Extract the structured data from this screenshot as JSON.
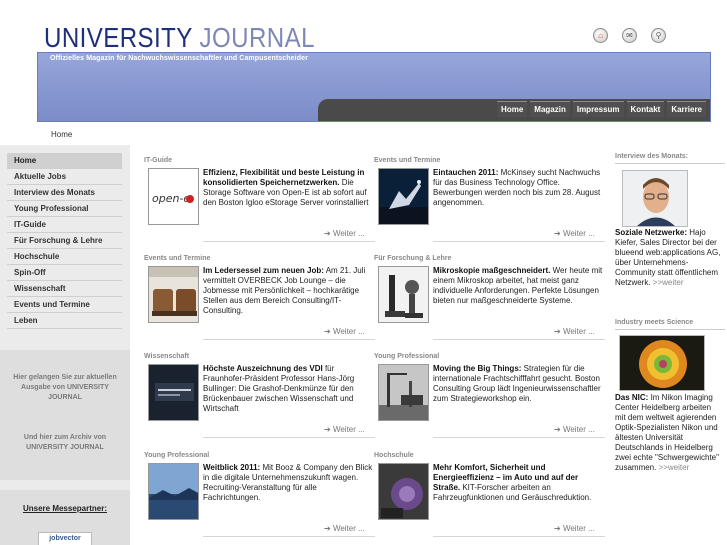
{
  "header": {
    "logo_part1": "UNIVERSITY",
    "logo_part2": "JOURNAL",
    "tagline": "Offizielles Magazin für Nachwuchswissenschaftler und Campusentscheider",
    "nav": [
      "Home",
      "Magazin",
      "Impressum",
      "Kontakt",
      "Karriere"
    ],
    "icons": [
      "home-icon",
      "mail-icon",
      "search-icon"
    ]
  },
  "breadcrumb": "Home",
  "sidebar": {
    "items": [
      {
        "label": "Home",
        "active": true
      },
      {
        "label": "Aktuelle Jobs"
      },
      {
        "label": "Interview des Monats"
      },
      {
        "label": "Young Professional"
      },
      {
        "label": "IT-Guide"
      },
      {
        "label": "Für Forschung & Lehre"
      },
      {
        "label": "Hochschule"
      },
      {
        "label": "Spin-Off"
      },
      {
        "label": "Wissenschaft"
      },
      {
        "label": "Events und Termine"
      },
      {
        "label": "Leben"
      }
    ],
    "archive_text_1": "Hier gelangen Sie zur aktuellen Ausgabe von UNIVERSITY JOURNAL",
    "archive_text_2": "Und hier zum Archiv von UNIVERSITY JOURNAL",
    "partner_title": "Unsere Messepartner:",
    "partner_logo": "jobvector"
  },
  "articles": [
    {
      "category": "IT-Guide",
      "title": "Effizienz, Flexibilität und beste Leistung in konsolidierten Speichernetzwerken.",
      "body": " Die Storage Software von Open-E ist ab sofort auf den Boston Igloo eStorage Server vorinstalliert",
      "more": "Weiter ...",
      "thumb_text": "open-e"
    },
    {
      "category": "Events und Termine",
      "title": "Eintauchen 2011:",
      "body": " McKinsey sucht Nachwuchs für das Business Technology Office. Bewerbungen werden noch bis zum 28. August angenommen.",
      "more": "Weiter ..."
    },
    {
      "category": "Events und Termine",
      "title": "Im Ledersessel zum neuen Job:",
      "body": " Am 21. Juli vermittelt OVERBECK Job Lounge – die Jobmesse mit Persönlichkeit – hochkarätige Stellen aus dem Bereich Consulting/IT-Consulting.",
      "more": "Weiter ..."
    },
    {
      "category": "Für Forschung & Lehre",
      "title": "Mikroskopie maßgeschneidert.",
      "body": " Wer heute mit einem Mikroskop arbeitet, hat meist ganz individuelle Anforderungen. Perfekte Lösungen bieten nur maßgeschneiderte Systeme.",
      "more": "Weiter ..."
    },
    {
      "category": "Wissenschaft",
      "title": "Höchste Auszeichnung des VDI",
      "body": " für Fraunhofer-Präsident Professor Hans-Jörg Bullinger: Die Grashof-Denkmünze für den Brückenbauer zwischen Wissenschaft und Wirtschaft",
      "more": "Weiter ..."
    },
    {
      "category": "Young Professional",
      "title": "Moving the Big Things:",
      "body": " Strategien für die internationale Frachtschifffahrt gesucht. Boston Consulting Group lädt Ingenieurwissenschaftler zum Strategieworkshop ein.",
      "more": "Weiter ..."
    },
    {
      "category": "Young Professional",
      "title": "Weitblick 2011:",
      "body": " Mit Booz & Company den Blick in die digitale Unternehmenszukunft wagen. Recruiting-Veranstaltung für alle Fachrichtungen.",
      "more": "Weiter ..."
    },
    {
      "category": "Hochschule",
      "title": "Mehr Komfort, Sicherheit und Energieeffizienz – im Auto und auf der Straße.",
      "body": " KIT-Forscher arbeiten an Fahrzeugfunktionen und Geräuschreduktion.",
      "more": "Weiter ..."
    }
  ],
  "right": {
    "interview_title": "Interview des Monats:",
    "interview_bold": "Soziale Netzwerke:",
    "interview_body": " Hajo Kiefer, Sales Director bei der blueend web:applications AG, über Unternehmens-Community statt öffentlichem Netzwerk. ",
    "interview_more": ">>weiter",
    "industry_title": "Industry meets Science",
    "industry_bold": "Das NIC:",
    "industry_body": " Im Nikon Imaging Center Heidelberg arbeiten mit dem weltweit agierenden Optik-Spezialisten Nikon und ältesten Universität Deutschlands in Heidelberg zwei echte \"Schwergewichte\" zusammen. ",
    "industry_more": ">>weiter"
  }
}
